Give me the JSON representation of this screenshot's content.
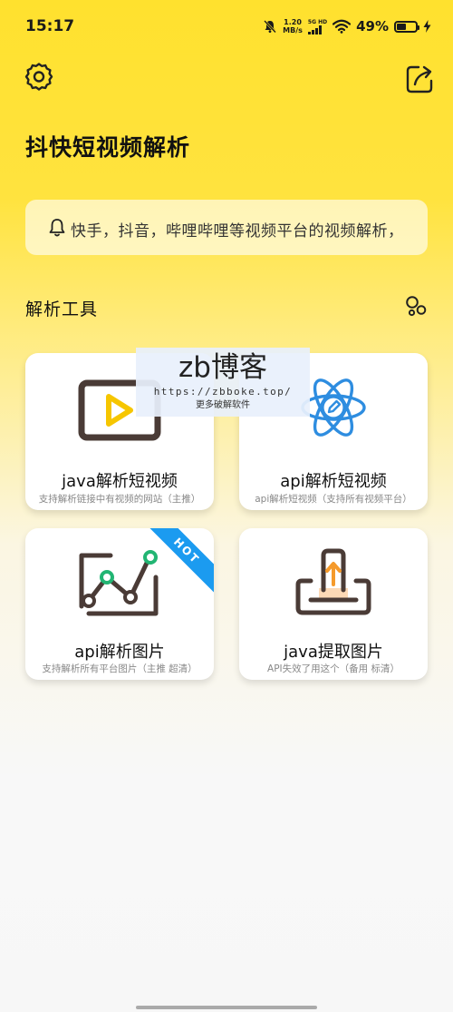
{
  "status_bar": {
    "time": "15:17",
    "net_speed_value": "1.20",
    "net_speed_unit": "MB/s",
    "signal_tag": "5G HD",
    "battery_percent": "49%",
    "battery_level": 0.49
  },
  "header": {
    "title": "抖快短视频解析",
    "settings_icon": "gear-icon",
    "share_icon": "share-icon"
  },
  "notice": {
    "icon": "bell-icon",
    "text": "快手，抖音，哔哩哔哩等视频平台的视频解析，"
  },
  "section": {
    "title": "解析工具",
    "more_icon": "bubbles-icon"
  },
  "tools": [
    {
      "title": "java解析短视频",
      "subtitle": "支持解析链接中有视频的网站（主推）",
      "icon": "video-player-icon"
    },
    {
      "title": "api解析短视频",
      "subtitle": "api解析短视频（支持所有视频平台）",
      "icon": "atom-edit-icon"
    },
    {
      "title": "api解析图片",
      "subtitle": "支持解析所有平台图片（主推 超清）",
      "icon": "line-chart-icon",
      "badge": "HOT"
    },
    {
      "title": "java提取图片",
      "subtitle": "API失效了用这个（备用 标清）",
      "icon": "upload-tray-icon"
    }
  ],
  "watermark": {
    "title": "zb博客",
    "url": "https://zbboke.top/",
    "note": "更多破解软件"
  },
  "colors": {
    "accent_yellow": "#FFE12E",
    "brand_dark": "#4A3B36",
    "play_yellow": "#F6C600",
    "chart_green": "#22B573",
    "atom_blue": "#2E8DE0",
    "hot_blue": "#1B9BF0",
    "hot_red": "#F0413C",
    "upload_orange": "#F59A2B"
  }
}
